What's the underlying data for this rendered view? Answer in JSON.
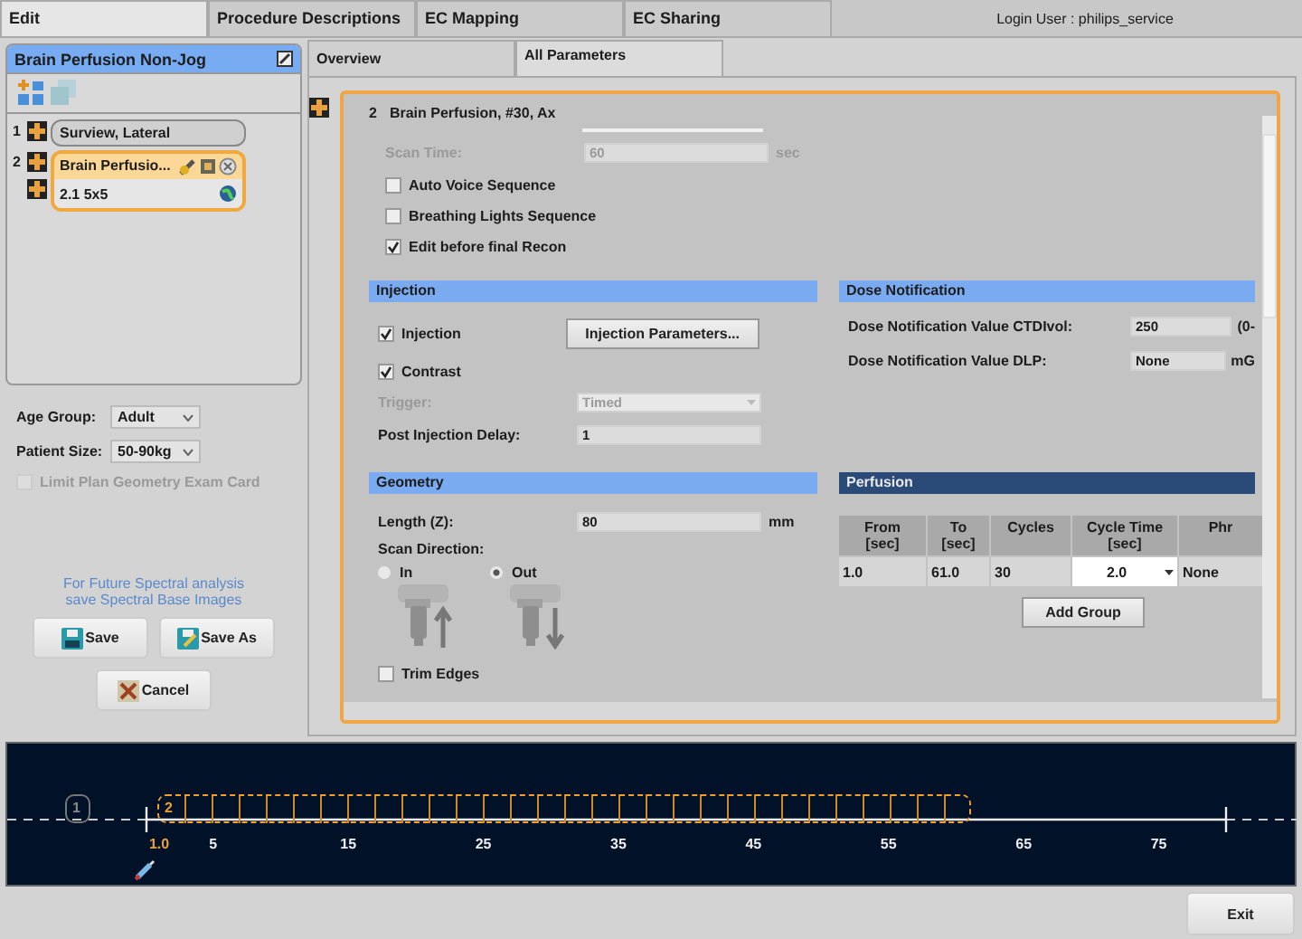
{
  "top_tabs": [
    {
      "label": "Edit",
      "selected": true
    },
    {
      "label": "Procedure Descriptions",
      "selected": false
    },
    {
      "label": "EC Mapping",
      "selected": false
    },
    {
      "label": "EC Sharing",
      "selected": false
    }
  ],
  "login_user": "Login User : philips_service",
  "protocol_panel": {
    "title": "Brain Perfusion Non-Jog",
    "scans": [
      {
        "number": "1",
        "label": "Surview, Lateral",
        "selected": false
      },
      {
        "number": "2",
        "label": "Brain Perfusio...",
        "selected": true,
        "recons": [
          {
            "label": "2.1 5x5"
          }
        ]
      }
    ]
  },
  "patient": {
    "fields": [
      {
        "label": "Age Group:",
        "value": "Adult"
      },
      {
        "label": "Patient Size:",
        "value": "50-90kg"
      }
    ],
    "limit_plan": {
      "label": "Limit Plan Geometry Exam Card",
      "checked": false,
      "disabled": true
    }
  },
  "spectral_note": "For Future Spectral analysis\nsave Spectral Base Images",
  "buttons": [
    {
      "kind": "save",
      "label": "Save"
    },
    {
      "kind": "save_as",
      "label": "Save As"
    },
    {
      "kind": "cancel",
      "label": "Cancel"
    }
  ],
  "sub_tabs": [
    {
      "label": "Overview",
      "selected": false
    },
    {
      "label": "All Parameters",
      "selected": true
    }
  ],
  "scan": {
    "number": "2",
    "title": "Brain Perfusion, #30, Ax",
    "scan_time": {
      "label": "Scan Time:",
      "value": "60",
      "unit": "sec",
      "disabled": true
    },
    "options": [
      {
        "label": "Auto Voice Sequence",
        "checked": false
      },
      {
        "label": "Breathing Lights Sequence",
        "checked": false
      },
      {
        "label": "Edit before final Recon",
        "checked": true
      }
    ]
  },
  "injection": {
    "title": "Injection",
    "checks": [
      {
        "label": "Injection",
        "checked": true
      },
      {
        "label": "Contrast",
        "checked": true
      }
    ],
    "button": "Injection Parameters...",
    "trigger": {
      "label": "Trigger:",
      "value": "Timed",
      "disabled": true
    },
    "post_delay": {
      "label": "Post Injection Delay:",
      "value": "1"
    }
  },
  "dose_notification": {
    "title": "Dose Notification",
    "rows": [
      {
        "label": "Dose Notification Value CTDIvol:",
        "value": "250",
        "unit": "(0-"
      },
      {
        "label": "Dose Notification Value DLP:",
        "value": "None",
        "unit": "mG"
      }
    ]
  },
  "geometry": {
    "title": "Geometry",
    "length": {
      "label": "Length (Z):",
      "value": "80",
      "unit": "mm"
    },
    "scan_direction": {
      "label": "Scan Direction:",
      "options": [
        {
          "label": "In",
          "selected": false
        },
        {
          "label": "Out",
          "selected": true
        }
      ]
    },
    "trim_edges": {
      "label": "Trim Edges",
      "checked": false
    }
  },
  "perfusion": {
    "title": "Perfusion",
    "columns": [
      "From\n[sec]",
      "To\n[sec]",
      "Cycles",
      "Cycle Time\n[sec]",
      "Phr"
    ],
    "rows": [
      [
        "1.0",
        "61.0",
        "30",
        "2.0",
        "None"
      ]
    ],
    "add_button": "Add Group"
  },
  "timeline": {
    "scans": [
      {
        "number": "1",
        "selected": false
      },
      {
        "number": "2",
        "selected": true
      }
    ],
    "ticks": [
      "1.0",
      "5",
      "15",
      "25",
      "35",
      "45",
      "55",
      "65",
      "75"
    ]
  },
  "exit_button": "Exit"
}
